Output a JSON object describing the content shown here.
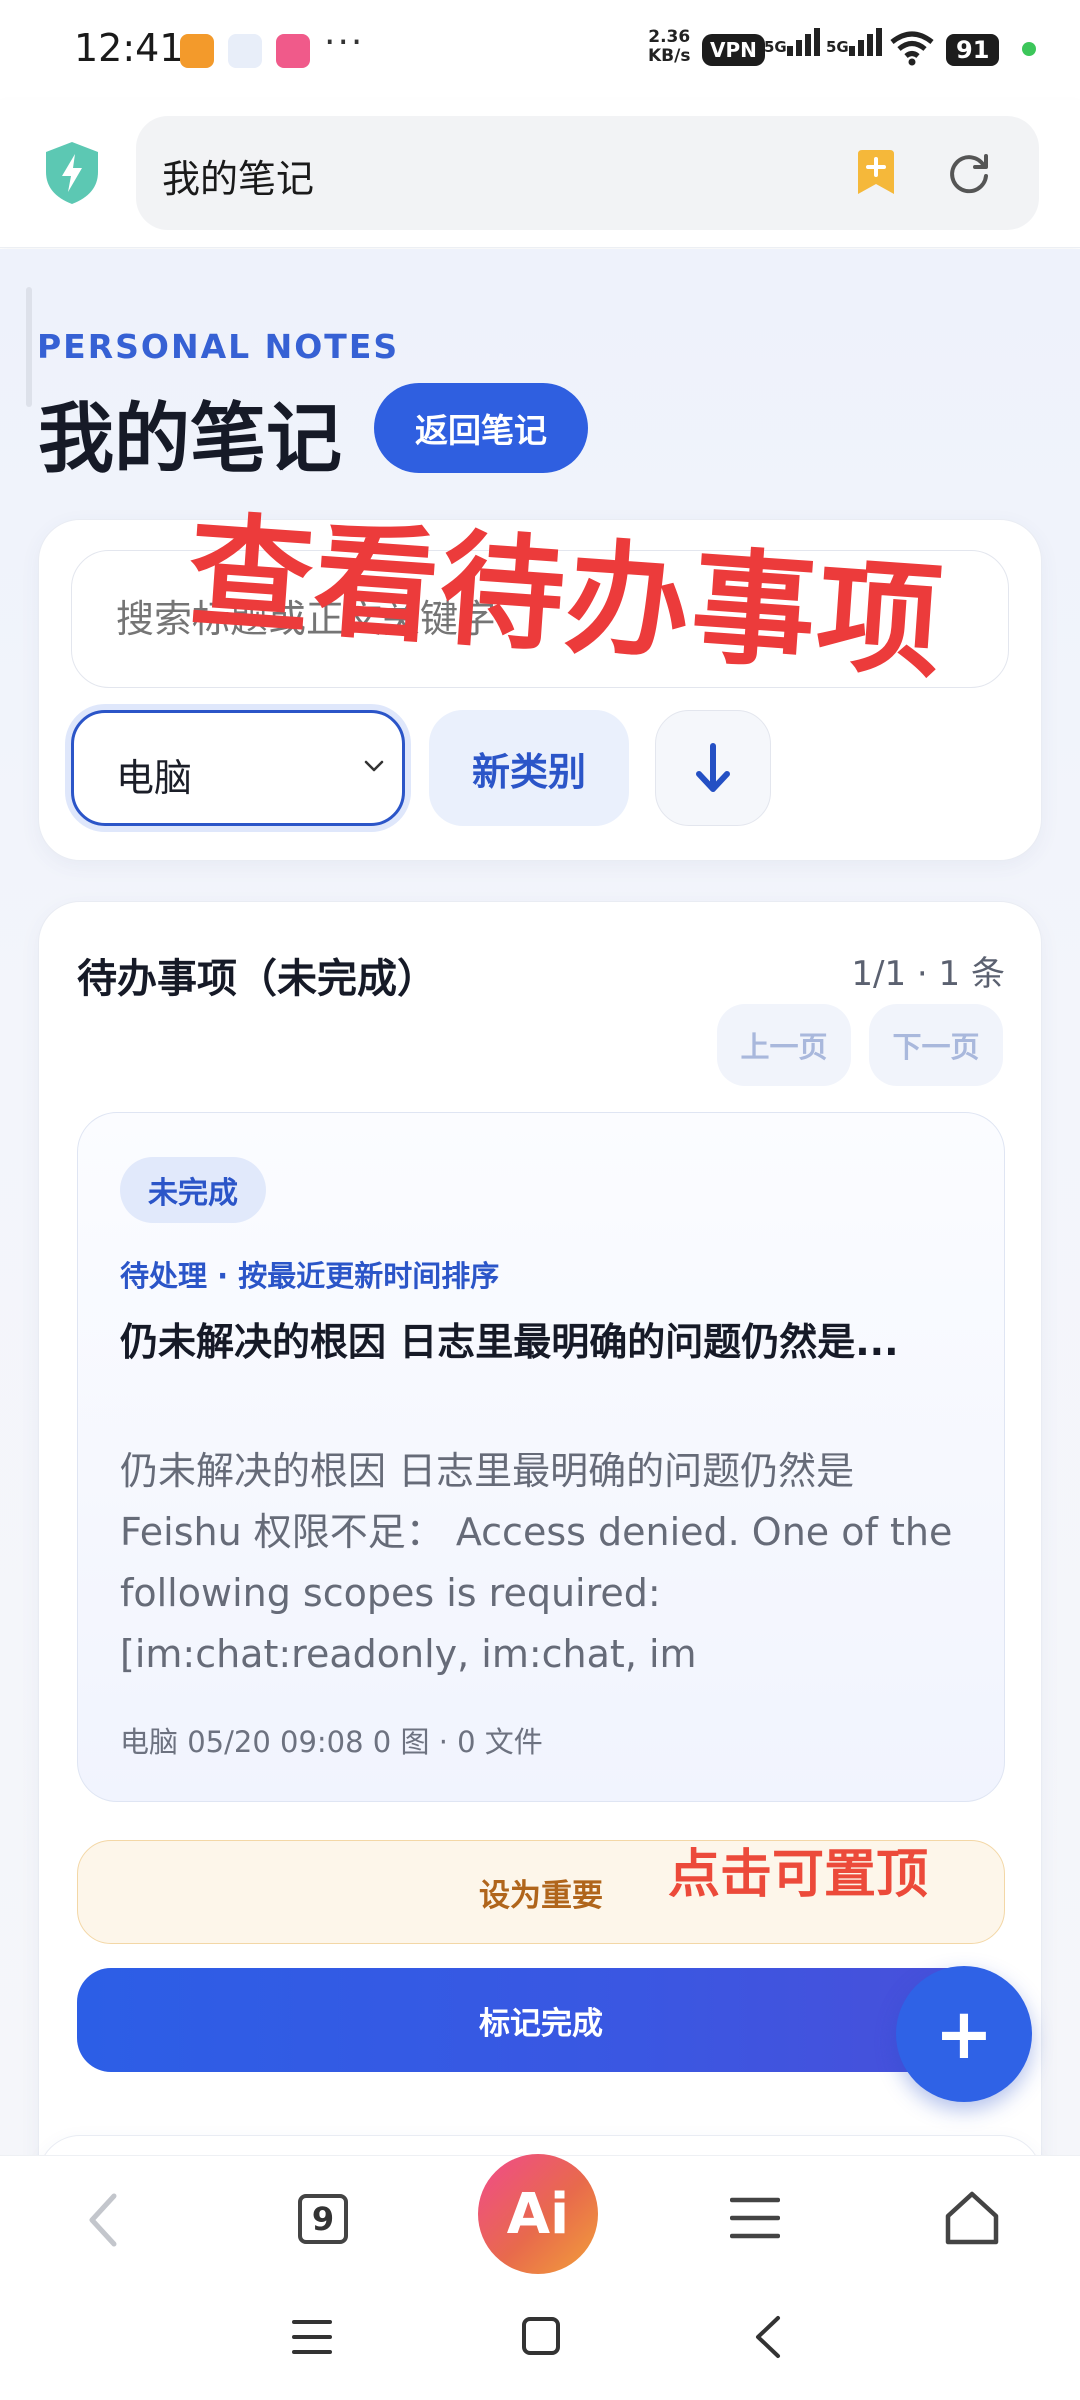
{
  "status_bar": {
    "time": "12:41",
    "more": "···",
    "net_speed_value": "2.36",
    "net_speed_unit": "KB/s",
    "vpn": "VPN",
    "sim1": "5G",
    "sim2": "5G",
    "battery": "91"
  },
  "browser": {
    "url_title": "我的笔记"
  },
  "header": {
    "eyebrow": "PERSONAL NOTES",
    "title": "我的笔记",
    "back_button": "返回笔记"
  },
  "filters": {
    "search_placeholder": "搜索标题或正文关键字",
    "category_value": "电脑",
    "new_category_button": "新类别",
    "sort_icon": "↓"
  },
  "list": {
    "title": "待办事项（未完成）",
    "page_count": "1/1 · 1 条",
    "prev_button": "上一页",
    "next_button": "下一页"
  },
  "note": {
    "badge": "未完成",
    "meta": "待处理 · 按最近更新时间排序",
    "title": "仍未解决的根因 日志里最明确的问题仍然是...",
    "body": "仍未解决的根因 日志里最明确的问题仍然是 Feishu 权限不足：  Access denied. One of the following scopes is required: [im:chat:readonly, im:chat, im",
    "footer": "电脑   05/20 09:08   0 图 · 0 文件"
  },
  "actions": {
    "important_button": "设为重要",
    "complete_button": "标记完成",
    "fab": "+"
  },
  "annotations": {
    "big": "查看待办事项",
    "small": "点击可置顶"
  },
  "bottom_nav": {
    "tabs_count": "9",
    "ai": "Ai"
  },
  "colors": {
    "accent": "#2f5fe0",
    "annotation_red": "#ec3b3b",
    "important_text": "#b0651b"
  }
}
